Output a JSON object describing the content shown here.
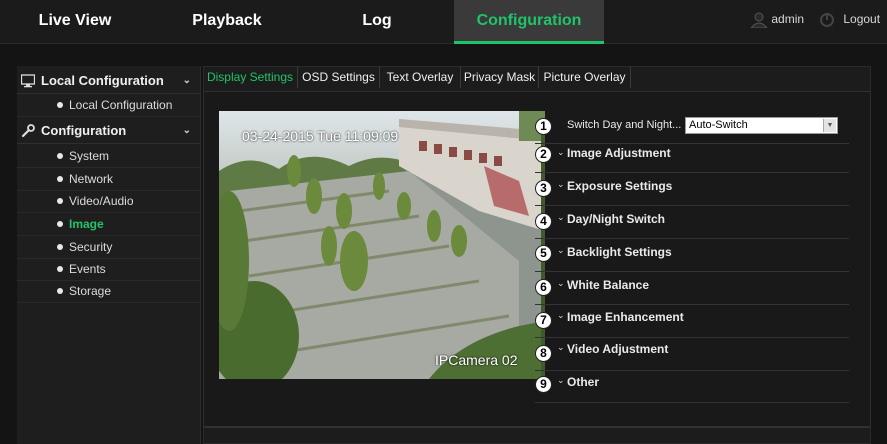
{
  "nav": {
    "tabs": [
      {
        "label": "Live View"
      },
      {
        "label": "Playback"
      },
      {
        "label": "Log"
      },
      {
        "label": "Configuration"
      }
    ],
    "user": "admin",
    "logout": "Logout"
  },
  "sidebar": {
    "groups": [
      {
        "label": "Local Configuration",
        "icon": "monitor-icon",
        "items": [
          {
            "label": "Local Configuration"
          }
        ]
      },
      {
        "label": "Configuration",
        "icon": "wrench-icon",
        "items": [
          {
            "label": "System"
          },
          {
            "label": "Network"
          },
          {
            "label": "Video/Audio"
          },
          {
            "label": "Image"
          },
          {
            "label": "Security"
          },
          {
            "label": "Events"
          },
          {
            "label": "Storage"
          }
        ]
      }
    ]
  },
  "tabs": [
    {
      "label": "Display Settings"
    },
    {
      "label": "OSD Settings"
    },
    {
      "label": "Text Overlay"
    },
    {
      "label": "Privacy Mask"
    },
    {
      "label": "Picture Overlay"
    }
  ],
  "video": {
    "timestamp": "03-24-2015 Tue 11:09:09",
    "camera_name": "IPCamera 02"
  },
  "settings": {
    "switch_label": "Switch Day and Night...",
    "switch_value": "Auto-Switch",
    "badges": [
      "1",
      "2",
      "3",
      "4",
      "5",
      "6",
      "7",
      "8",
      "9"
    ],
    "sections": [
      {
        "label": "Image Adjustment"
      },
      {
        "label": "Exposure Settings"
      },
      {
        "label": "Day/Night Switch"
      },
      {
        "label": "Backlight Settings"
      },
      {
        "label": "White Balance"
      },
      {
        "label": "Image Enhancement"
      },
      {
        "label": "Video Adjustment"
      },
      {
        "label": "Other"
      }
    ]
  },
  "colors": {
    "accent": "#1fc468",
    "background": "#141414"
  }
}
